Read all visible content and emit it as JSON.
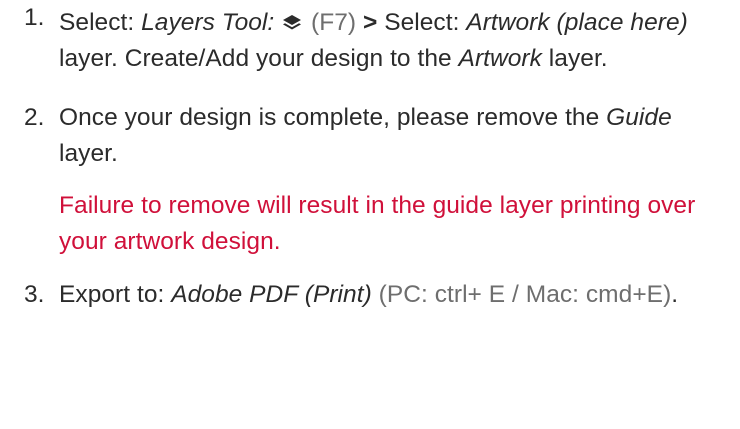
{
  "colors": {
    "text": "#2b2b2b",
    "muted": "#6e6e6e",
    "warning": "#d0103a"
  },
  "steps": [
    {
      "number": "1.",
      "select_label": "Select:",
      "layers_tool": "Layers Tool:",
      "layers_icon": "layers-icon",
      "shortcut": "(F7)",
      "arrow": ">",
      "select_label_2": "Select:",
      "artwork_layer": "Artwork (place here)",
      "text_after_layer": "layer. Create/Add your design to the",
      "artwork_name": "Artwork",
      "text_end": "layer."
    },
    {
      "number": "2.",
      "text_before": "Once your design is complete, please remove the",
      "guide_name": "Guide",
      "text_after": "layer.",
      "warning": "Failure to remove will result in the guide layer printing over your artwork design."
    },
    {
      "number": "3.",
      "export_label": "Export to:",
      "export_target": "Adobe PDF (Print)",
      "shortcuts": "(PC: ctrl+ E / Mac: cmd+E)",
      "end": "."
    }
  ]
}
